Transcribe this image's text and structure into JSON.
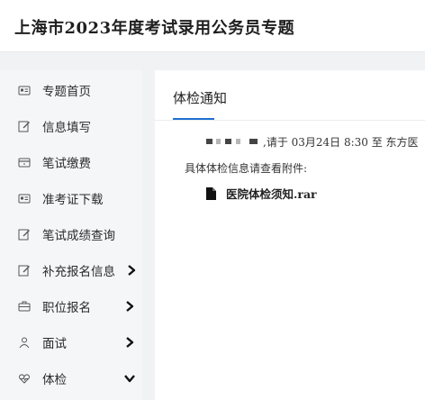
{
  "header": {
    "title": "上海市2023年度考试录用公务员专题"
  },
  "sidebar": {
    "items": [
      {
        "label": "专题首页",
        "icon": "id-card-icon"
      },
      {
        "label": "信息填写",
        "icon": "edit-icon"
      },
      {
        "label": "笔试缴费",
        "icon": "payment-card-icon"
      },
      {
        "label": "准考证下载",
        "icon": "id-card-icon"
      },
      {
        "label": "笔试成绩查询",
        "icon": "edit-icon"
      },
      {
        "label": "补充报名信息",
        "icon": "edit-icon",
        "arrow": "chevron-right-icon"
      },
      {
        "label": "职位报名",
        "icon": "briefcase-icon",
        "arrow": "chevron-right-icon"
      },
      {
        "label": "面试",
        "icon": "person-icon",
        "arrow": "chevron-right-icon"
      },
      {
        "label": "体检",
        "icon": "heart-icon",
        "arrow": "chevron-down-icon"
      }
    ]
  },
  "main": {
    "title": "体检通知",
    "notice_line1": ",请于 03月24日 8:30 至 东方医",
    "notice_line2": "具体体检信息请查看附件:",
    "attachment": "医院体检须知.rar"
  },
  "colors": {
    "accent": "#1f6fd1",
    "sidebar_bg": "#f5f6f8",
    "page_bg": "#f1f2f4"
  }
}
